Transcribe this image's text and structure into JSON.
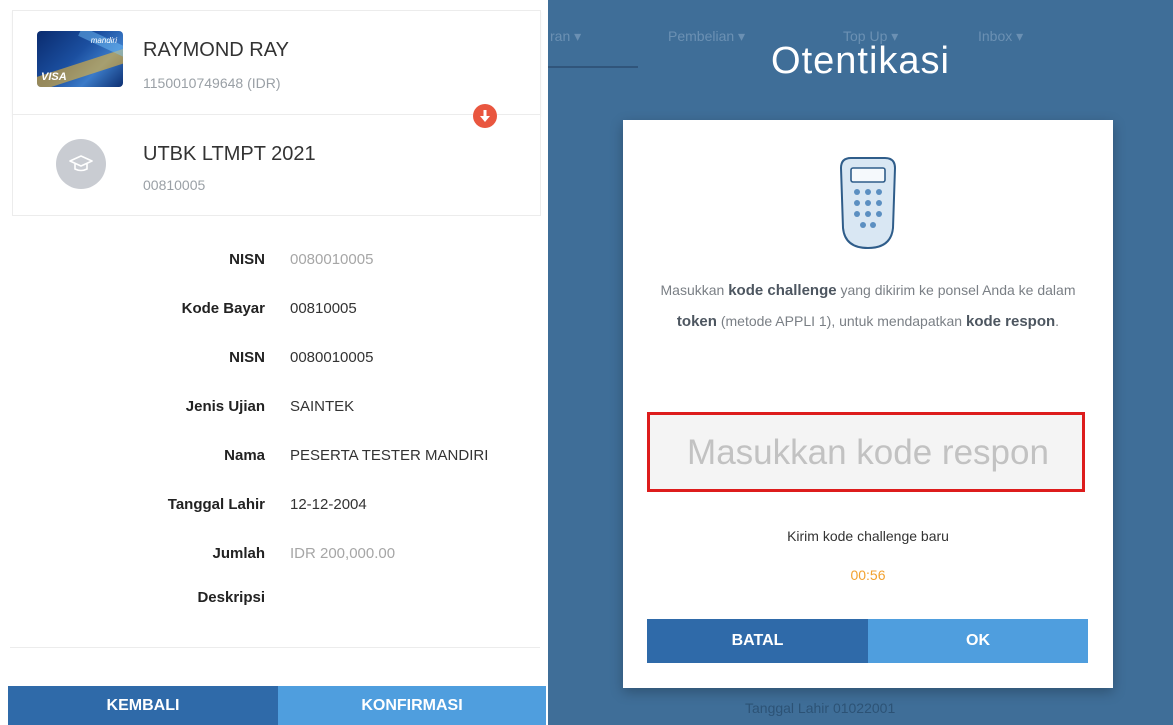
{
  "card": {
    "holder_name": "RAYMOND RAY",
    "account_number": "1150010749648 (IDR)",
    "brand": "mandiri",
    "network": "VISA"
  },
  "biller": {
    "name": "UTBK LTMPT 2021",
    "code": "00810005"
  },
  "details": [
    {
      "label": "NISN",
      "value": "0080010005"
    },
    {
      "label": "Kode Bayar",
      "value": "00810005"
    },
    {
      "label": "NISN",
      "value": "0080010005"
    },
    {
      "label": "Jenis Ujian",
      "value": "SAINTEK"
    },
    {
      "label": "Nama",
      "value": "PESERTA TESTER MANDIRI"
    },
    {
      "label": "Tanggal Lahir",
      "value": "12-12-2004"
    },
    {
      "label": "Jumlah",
      "value": "IDR 200,000.00"
    },
    {
      "label": "Deskripsi",
      "value": ""
    }
  ],
  "left_buttons": {
    "back": "KEMBALI",
    "confirm": "KONFIRMASI"
  },
  "background_nav": [
    "ran ▾",
    "Pembelian ▾",
    "Top Up ▾",
    "Inbox ▾"
  ],
  "background_footer": "Tanggal Lahir   01022001",
  "auth": {
    "title": "Otentikasi",
    "instr_1": "Masukkan ",
    "instr_2": "kode challenge",
    "instr_3": " yang dikirim ke ponsel Anda ke dalam ",
    "instr_4": "token",
    "instr_5": " (metode APPLI 1), untuk mendapatkan ",
    "instr_6": "kode respon",
    "instr_7": ".",
    "input_value": "",
    "input_placeholder": "Masukkan kode respon",
    "resend_label": "Kirim kode challenge baru",
    "timer": "00:56",
    "cancel_label": "BATAL",
    "ok_label": "OK"
  },
  "colors": {
    "primary_dark": "#2f6aa9",
    "primary_light": "#4f9ede",
    "overlay_bg": "#3f6e98",
    "alert": "#e9563f",
    "highlight_border": "#dd1c1c",
    "timer": "#f2a230"
  },
  "icons": {
    "alert": "download-arrow-icon",
    "biller": "graduation-cap-icon",
    "token": "token-device-icon"
  }
}
